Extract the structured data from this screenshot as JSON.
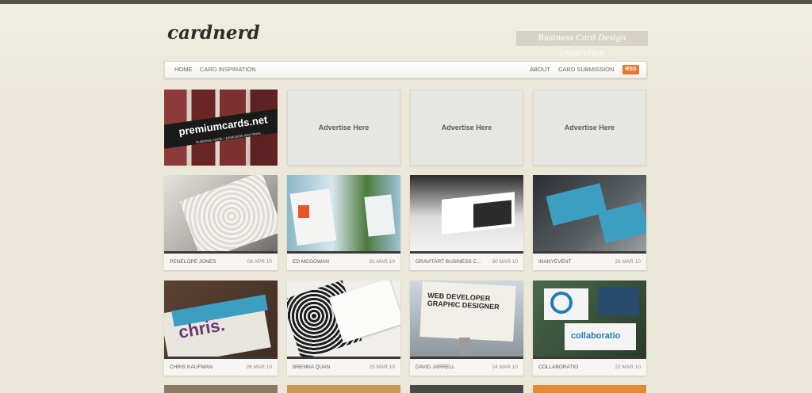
{
  "header": {
    "logo": "cardnerd",
    "tagline": "Business Card Design Inspiration"
  },
  "nav": {
    "home": "HOME",
    "inspiration": "CARD INSPIRATION",
    "about": "ABOUT",
    "submission": "CARD SUBMISSION",
    "rss": "RSS"
  },
  "promo": {
    "title": "premiumcards.net",
    "subtitle": "business cards • postcards and more..."
  },
  "ads": [
    "Advertise Here",
    "Advertise Here",
    "Advertise Here"
  ],
  "cards": [
    {
      "name": "PENELOPE JONES",
      "date": "06 APR 10"
    },
    {
      "name": "ED MCGOWAN",
      "date": "31 MAR 10"
    },
    {
      "name": "GRAVITART BUSINESS C...",
      "date": "30 MAR 10"
    },
    {
      "name": "INANYEVENT",
      "date": "26 MAR 10"
    },
    {
      "name": "CHRIS KAUFMAN",
      "date": "26 MAR 10"
    },
    {
      "name": "BRENNA QUAN",
      "date": "25 MAR 10"
    },
    {
      "name": "DAVID JARRELL",
      "date": "24 MAR 10"
    },
    {
      "name": "COLLABORATIO",
      "date": "22 MAR 10"
    }
  ],
  "colors": {
    "background": "#ebe8d9",
    "rss": "#e5782a",
    "caption_bar": "#3b3a38"
  }
}
